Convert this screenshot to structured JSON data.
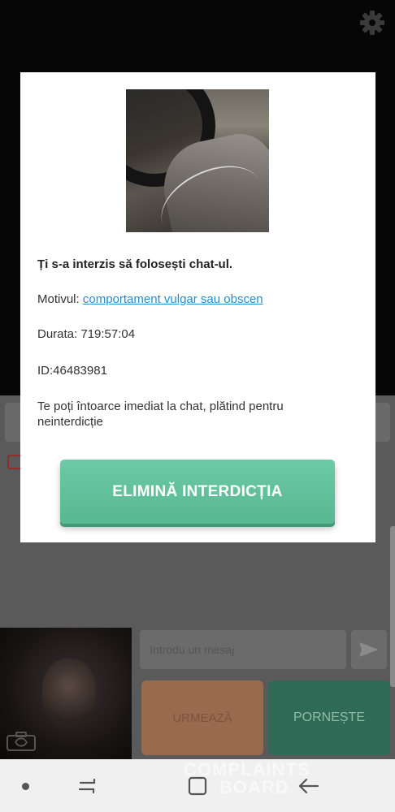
{
  "dialog": {
    "title": "Ți s-a interzis să folosești chat-ul.",
    "reason_label": "Motivul: ",
    "reason_link": "comportament vulgar sau obscen",
    "duration": "Durata: 719:57:04",
    "id": "ID:46483981",
    "info": "Te poți întoarce imediat la chat, plătind pentru neinterdicție",
    "button_label": "ELIMINĂ INTERDICȚIA"
  },
  "chat": {
    "message_placeholder": "Introdu un mesaj",
    "next_button": "URMEAZĂ",
    "start_button": "PORNEȘTE"
  },
  "watermark": {
    "line1": "COMPLAINTS",
    "line2": "BOARD"
  },
  "icons": {
    "settings": "gear-icon",
    "send": "send-icon",
    "camera_switch": "camera-switch-icon",
    "nav_recents": "recents-icon",
    "nav_home": "home-icon",
    "nav_back": "back-icon"
  },
  "colors": {
    "accent_green": "#5fc09a",
    "link_blue": "#2a8bc6",
    "next_button": "#9a6a4e",
    "start_button": "#2e6a55"
  }
}
